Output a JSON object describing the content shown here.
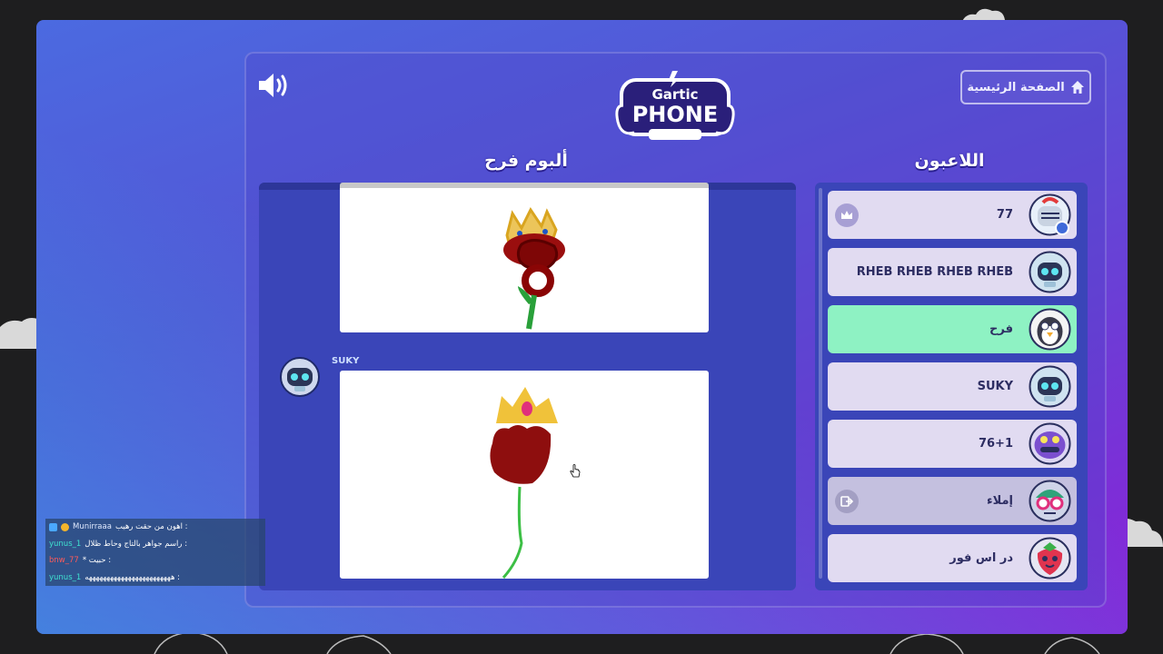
{
  "header": {
    "home_label": "الصفحة الرئيسية",
    "logo_top": "Gartic",
    "logo_bottom": "PHONE"
  },
  "album": {
    "title": "ألبوم فرح",
    "entries": [
      {
        "author": "SUKY"
      }
    ]
  },
  "players": {
    "title": "اللاعبون",
    "list": [
      {
        "name": "77"
      },
      {
        "name": "RHEB RHEB RHEB RHEB"
      },
      {
        "name": "فرح"
      },
      {
        "name": "SUKY"
      },
      {
        "name": "76+1"
      },
      {
        "name": "إملاء"
      },
      {
        "name": "در اس فور"
      }
    ]
  },
  "chat": [
    {
      "user": "Munirraaa",
      "message": "اهون من حقت رهيب :"
    },
    {
      "user": "yunus_1",
      "message": "راسم جواهر بالتاج وحاط ظلال :"
    },
    {
      "user": "bnw_77",
      "message": "* حبيت :"
    },
    {
      "user": "yunus_1",
      "message": "ههههههههههههههههههههههههه :"
    }
  ],
  "colors": {
    "active_player": "#8ef2c3",
    "player_card": "#e1dbf1",
    "album_bg": "#3a45b8"
  }
}
